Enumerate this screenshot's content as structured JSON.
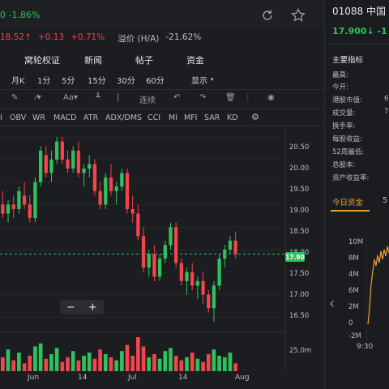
{
  "header": {
    "price_change": "0 -1.86%",
    "refresh_icon": "refresh-icon",
    "star_icon": "star-icon"
  },
  "quote": {
    "h_price": "18.52",
    "change": "+0.13",
    "change_pct": "+0.71%",
    "premium_label": "溢价 (H/A)",
    "premium_value": "-21.62%"
  },
  "tabs": [
    "窝轮权证",
    "新闻",
    "帖子",
    "资金"
  ],
  "periods": [
    "月K",
    "1分",
    "5分",
    "15分",
    "30分",
    "60分",
    "显示"
  ],
  "tools": {
    "label_text": "Aa",
    "connect": "连续"
  },
  "indicators": [
    "I",
    "OBV",
    "WR",
    "MACD",
    "ATR",
    "ADX/DMS",
    "CCI",
    "MI",
    "MFI",
    "SAR",
    "KD"
  ],
  "price_axis": [
    "20.50",
    "20.00",
    "19.50",
    "19.00",
    "18.50",
    "18.00",
    "17.50",
    "17.00",
    "16.50"
  ],
  "vol_axis": "25.0m",
  "current_price_tag": "17.90",
  "x_labels": [
    "Jun",
    "14",
    "Jul",
    "14",
    "Aug"
  ],
  "zoom": {
    "minus": "−",
    "plus": "+"
  },
  "right": {
    "title": "01088 中国",
    "price": "17.900↓ -1",
    "section": "主要指标",
    "stats": [
      "最高:",
      "今开:",
      "港股市值:",
      "成交量:",
      "换手率:",
      "每股收益:",
      "52周最低:",
      "总股本:",
      "资产收益率:"
    ],
    "stat_vals": [
      "",
      "",
      "6",
      "7",
      "",
      "",
      "",
      "",
      ""
    ],
    "tab_today": "今日资金",
    "tab_next": "5",
    "flow_axis": [
      "10M",
      "6M",
      "2M",
      "-2M"
    ],
    "flow_axis_extra": [
      "8M",
      "4M",
      "0"
    ],
    "time_label": "9:30",
    "nav_icon": "chevron-left-icon"
  },
  "chart_data": {
    "type": "candlestick",
    "x": [
      "Jun",
      "14",
      "Jul",
      "14",
      "Aug"
    ],
    "ylim": [
      16.2,
      20.7
    ],
    "current_price": 17.9,
    "series": [
      {
        "o": 19.0,
        "h": 19.3,
        "l": 18.7,
        "c": 18.8
      },
      {
        "o": 18.8,
        "h": 19.1,
        "l": 18.6,
        "c": 19.0
      },
      {
        "o": 19.0,
        "h": 19.2,
        "l": 18.7,
        "c": 18.9
      },
      {
        "o": 18.9,
        "h": 19.4,
        "l": 18.8,
        "c": 19.3
      },
      {
        "o": 19.2,
        "h": 19.5,
        "l": 18.9,
        "c": 19.0
      },
      {
        "o": 19.0,
        "h": 19.2,
        "l": 18.6,
        "c": 18.7
      },
      {
        "o": 18.7,
        "h": 19.6,
        "l": 18.6,
        "c": 19.5
      },
      {
        "o": 19.5,
        "h": 20.3,
        "l": 19.4,
        "c": 20.2
      },
      {
        "o": 20.1,
        "h": 20.3,
        "l": 19.6,
        "c": 19.7
      },
      {
        "o": 19.7,
        "h": 20.2,
        "l": 19.5,
        "c": 20.0
      },
      {
        "o": 20.0,
        "h": 20.5,
        "l": 19.9,
        "c": 20.4
      },
      {
        "o": 20.4,
        "h": 20.5,
        "l": 19.9,
        "c": 20.0
      },
      {
        "o": 20.0,
        "h": 20.2,
        "l": 19.7,
        "c": 19.8
      },
      {
        "o": 19.8,
        "h": 20.3,
        "l": 19.7,
        "c": 20.2
      },
      {
        "o": 20.2,
        "h": 20.4,
        "l": 19.6,
        "c": 19.7
      },
      {
        "o": 19.7,
        "h": 19.9,
        "l": 19.4,
        "c": 19.8
      },
      {
        "o": 19.8,
        "h": 20.1,
        "l": 19.6,
        "c": 19.9
      },
      {
        "o": 19.9,
        "h": 20.0,
        "l": 19.2,
        "c": 19.3
      },
      {
        "o": 19.3,
        "h": 19.5,
        "l": 18.9,
        "c": 19.0
      },
      {
        "o": 19.0,
        "h": 19.7,
        "l": 18.9,
        "c": 19.6
      },
      {
        "o": 19.6,
        "h": 19.9,
        "l": 19.2,
        "c": 19.3
      },
      {
        "o": 19.3,
        "h": 19.5,
        "l": 19.0,
        "c": 19.4
      },
      {
        "o": 19.4,
        "h": 19.8,
        "l": 19.3,
        "c": 19.7
      },
      {
        "o": 19.7,
        "h": 19.8,
        "l": 18.8,
        "c": 18.9
      },
      {
        "o": 18.9,
        "h": 19.2,
        "l": 18.6,
        "c": 18.8
      },
      {
        "o": 18.8,
        "h": 19.0,
        "l": 18.2,
        "c": 18.3
      },
      {
        "o": 18.3,
        "h": 18.5,
        "l": 17.5,
        "c": 17.6
      },
      {
        "o": 17.6,
        "h": 18.0,
        "l": 17.4,
        "c": 17.9
      },
      {
        "o": 17.9,
        "h": 18.1,
        "l": 17.3,
        "c": 17.4
      },
      {
        "o": 17.4,
        "h": 17.9,
        "l": 17.3,
        "c": 17.8
      },
      {
        "o": 17.8,
        "h": 18.2,
        "l": 17.7,
        "c": 18.1
      },
      {
        "o": 18.1,
        "h": 18.6,
        "l": 18.0,
        "c": 18.5
      },
      {
        "o": 18.5,
        "h": 18.6,
        "l": 17.6,
        "c": 17.7
      },
      {
        "o": 17.7,
        "h": 17.8,
        "l": 17.2,
        "c": 17.3
      },
      {
        "o": 17.3,
        "h": 17.6,
        "l": 17.0,
        "c": 17.5
      },
      {
        "o": 17.5,
        "h": 17.7,
        "l": 17.1,
        "c": 17.2
      },
      {
        "o": 17.2,
        "h": 17.4,
        "l": 16.9,
        "c": 17.3
      },
      {
        "o": 17.3,
        "h": 17.5,
        "l": 16.8,
        "c": 17.0
      },
      {
        "o": 17.0,
        "h": 17.1,
        "l": 16.6,
        "c": 16.7
      },
      {
        "o": 16.7,
        "h": 17.3,
        "l": 16.4,
        "c": 17.2
      },
      {
        "o": 17.2,
        "h": 17.9,
        "l": 17.1,
        "c": 17.8
      },
      {
        "o": 17.8,
        "h": 18.1,
        "l": 17.6,
        "c": 18.0
      },
      {
        "o": 18.0,
        "h": 18.3,
        "l": 17.9,
        "c": 18.2
      },
      {
        "o": 18.2,
        "h": 18.4,
        "l": 17.8,
        "c": 17.9
      }
    ],
    "volume": [
      9,
      14,
      7,
      12,
      5,
      10,
      16,
      18,
      8,
      11,
      15,
      6,
      9,
      13,
      7,
      10,
      12,
      8,
      14,
      11,
      9,
      7,
      13,
      17,
      10,
      22,
      16,
      9,
      11,
      8,
      13,
      15,
      10,
      7,
      9,
      12,
      8,
      6,
      11,
      14,
      10,
      9,
      12,
      5
    ]
  }
}
